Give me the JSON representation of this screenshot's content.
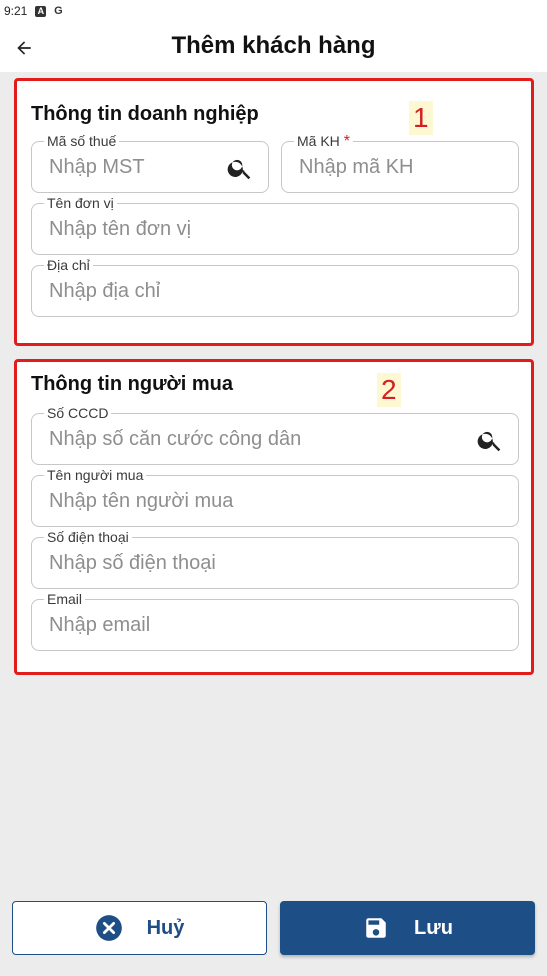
{
  "status_bar": {
    "time": "9:21",
    "icons": [
      "a-badge-icon",
      "google-icon"
    ],
    "icon_g": "G",
    "icon_a": "A"
  },
  "header": {
    "title": "Thêm khách hàng",
    "back_icon": "arrow-left-icon"
  },
  "section_business": {
    "title": "Thông tin doanh nghiệp",
    "annotation": "1",
    "tax_code": {
      "label": "Mã số thuế",
      "placeholder": "Nhập MST"
    },
    "customer_code": {
      "label": "Mã KH",
      "required_mark": "*",
      "placeholder": "Nhập mã KH"
    },
    "unit_name": {
      "label": "Tên đơn vị",
      "placeholder": "Nhập tên đơn vị"
    },
    "address": {
      "label": "Địa chỉ",
      "placeholder": "Nhập địa chỉ"
    }
  },
  "section_buyer": {
    "title": "Thông tin người mua",
    "annotation": "2",
    "citizen_id": {
      "label": "Số CCCD",
      "placeholder": "Nhập số căn cước công dân"
    },
    "buyer_name": {
      "label": "Tên người mua",
      "placeholder": "Nhập tên người mua"
    },
    "phone": {
      "label": "Số điện thoại",
      "placeholder": "Nhập số điện thoại"
    },
    "email": {
      "label": "Email",
      "placeholder": "Nhập email"
    }
  },
  "actions": {
    "cancel_label": "Huỷ",
    "save_label": "Lưu"
  },
  "colors": {
    "accent": "#1e4e86",
    "annotation_border": "#e21b1b",
    "required": "#d42020"
  }
}
